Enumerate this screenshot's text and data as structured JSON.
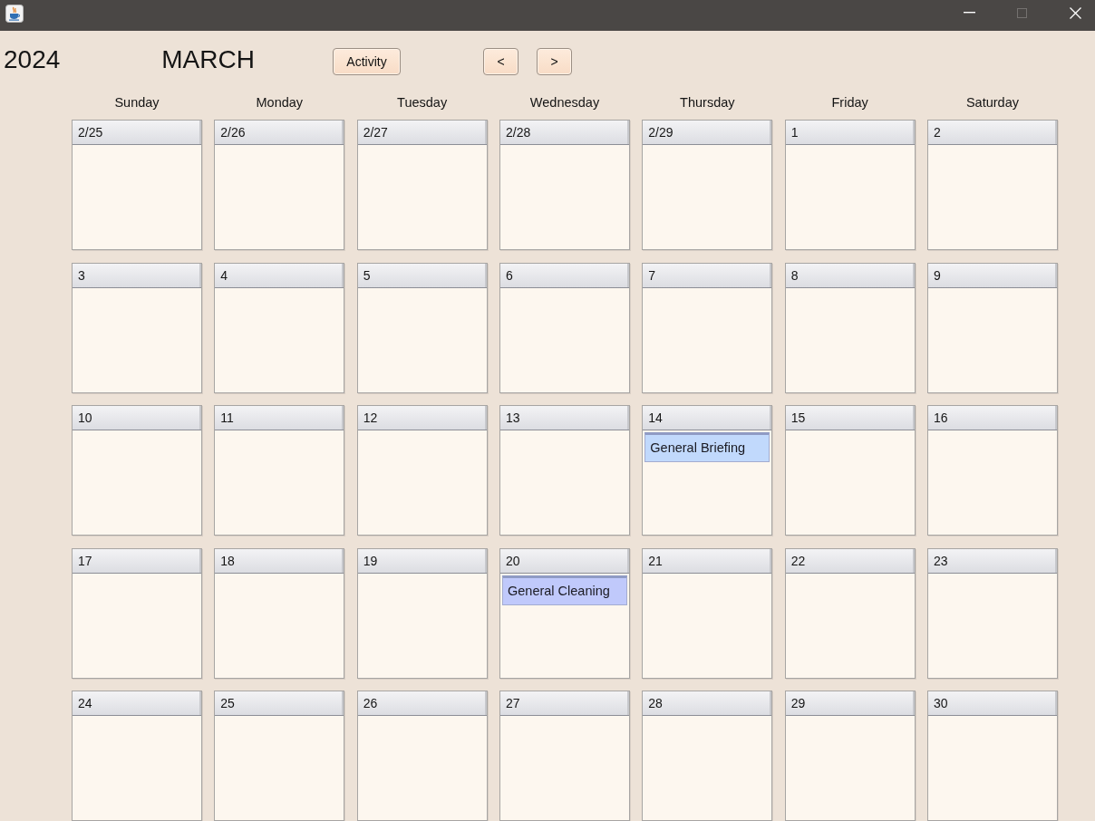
{
  "window": {
    "controls": [
      {
        "kind": "minimize",
        "disabled": false
      },
      {
        "kind": "maximize",
        "disabled": true
      },
      {
        "kind": "close",
        "disabled": false
      }
    ]
  },
  "header": {
    "year": "2024",
    "month": "MARCH",
    "buttons": [
      {
        "kind": "activity",
        "label": "Activity"
      },
      {
        "kind": "prev",
        "label": "<"
      },
      {
        "kind": "next",
        "label": ">"
      }
    ]
  },
  "weekdays": [
    "Sunday",
    "Monday",
    "Tuesday",
    "Wednesday",
    "Thursday",
    "Friday",
    "Saturday"
  ],
  "weeks": [
    {
      "days": [
        {
          "date": "2/25"
        },
        {
          "date": "2/26"
        },
        {
          "date": "2/27"
        },
        {
          "date": "2/28"
        },
        {
          "date": "2/29"
        },
        {
          "date": "1"
        },
        {
          "date": "2"
        }
      ]
    },
    {
      "days": [
        {
          "date": "3"
        },
        {
          "date": "4"
        },
        {
          "date": "5"
        },
        {
          "date": "6"
        },
        {
          "date": "7"
        },
        {
          "date": "8"
        },
        {
          "date": "9"
        }
      ]
    },
    {
      "days": [
        {
          "date": "10"
        },
        {
          "date": "11"
        },
        {
          "date": "12"
        },
        {
          "date": "13"
        },
        {
          "date": "14",
          "events": [
            {
              "title": "General Briefing",
              "color": "#c1d9fc"
            }
          ]
        },
        {
          "date": "15"
        },
        {
          "date": "16"
        }
      ]
    },
    {
      "days": [
        {
          "date": "17"
        },
        {
          "date": "18"
        },
        {
          "date": "19"
        },
        {
          "date": "20",
          "events": [
            {
              "title": "General Cleaning",
              "color": "#c0c9fb"
            }
          ]
        },
        {
          "date": "21"
        },
        {
          "date": "22"
        },
        {
          "date": "23"
        }
      ]
    },
    {
      "days": [
        {
          "date": "24"
        },
        {
          "date": "25"
        },
        {
          "date": "26"
        },
        {
          "date": "27"
        },
        {
          "date": "28"
        },
        {
          "date": "29"
        },
        {
          "date": "30"
        }
      ]
    }
  ]
}
